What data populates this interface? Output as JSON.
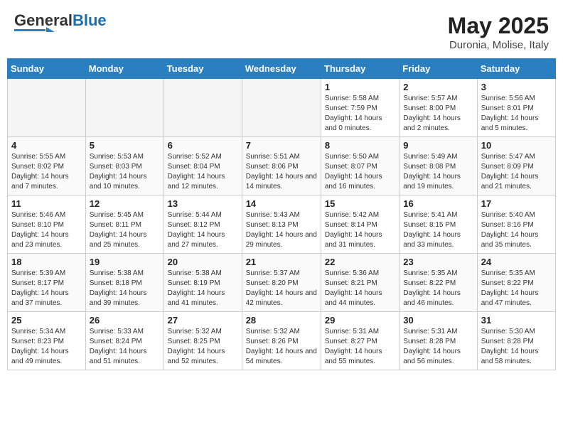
{
  "header": {
    "logo_general": "General",
    "logo_blue": "Blue",
    "month_title": "May 2025",
    "location": "Duronia, Molise, Italy"
  },
  "days_of_week": [
    "Sunday",
    "Monday",
    "Tuesday",
    "Wednesday",
    "Thursday",
    "Friday",
    "Saturday"
  ],
  "weeks": [
    [
      {
        "num": "",
        "info": ""
      },
      {
        "num": "",
        "info": ""
      },
      {
        "num": "",
        "info": ""
      },
      {
        "num": "",
        "info": ""
      },
      {
        "num": "1",
        "info": "Sunrise: 5:58 AM\nSunset: 7:59 PM\nDaylight: 14 hours and 0 minutes."
      },
      {
        "num": "2",
        "info": "Sunrise: 5:57 AM\nSunset: 8:00 PM\nDaylight: 14 hours and 2 minutes."
      },
      {
        "num": "3",
        "info": "Sunrise: 5:56 AM\nSunset: 8:01 PM\nDaylight: 14 hours and 5 minutes."
      }
    ],
    [
      {
        "num": "4",
        "info": "Sunrise: 5:55 AM\nSunset: 8:02 PM\nDaylight: 14 hours and 7 minutes."
      },
      {
        "num": "5",
        "info": "Sunrise: 5:53 AM\nSunset: 8:03 PM\nDaylight: 14 hours and 10 minutes."
      },
      {
        "num": "6",
        "info": "Sunrise: 5:52 AM\nSunset: 8:04 PM\nDaylight: 14 hours and 12 minutes."
      },
      {
        "num": "7",
        "info": "Sunrise: 5:51 AM\nSunset: 8:06 PM\nDaylight: 14 hours and 14 minutes."
      },
      {
        "num": "8",
        "info": "Sunrise: 5:50 AM\nSunset: 8:07 PM\nDaylight: 14 hours and 16 minutes."
      },
      {
        "num": "9",
        "info": "Sunrise: 5:49 AM\nSunset: 8:08 PM\nDaylight: 14 hours and 19 minutes."
      },
      {
        "num": "10",
        "info": "Sunrise: 5:47 AM\nSunset: 8:09 PM\nDaylight: 14 hours and 21 minutes."
      }
    ],
    [
      {
        "num": "11",
        "info": "Sunrise: 5:46 AM\nSunset: 8:10 PM\nDaylight: 14 hours and 23 minutes."
      },
      {
        "num": "12",
        "info": "Sunrise: 5:45 AM\nSunset: 8:11 PM\nDaylight: 14 hours and 25 minutes."
      },
      {
        "num": "13",
        "info": "Sunrise: 5:44 AM\nSunset: 8:12 PM\nDaylight: 14 hours and 27 minutes."
      },
      {
        "num": "14",
        "info": "Sunrise: 5:43 AM\nSunset: 8:13 PM\nDaylight: 14 hours and 29 minutes."
      },
      {
        "num": "15",
        "info": "Sunrise: 5:42 AM\nSunset: 8:14 PM\nDaylight: 14 hours and 31 minutes."
      },
      {
        "num": "16",
        "info": "Sunrise: 5:41 AM\nSunset: 8:15 PM\nDaylight: 14 hours and 33 minutes."
      },
      {
        "num": "17",
        "info": "Sunrise: 5:40 AM\nSunset: 8:16 PM\nDaylight: 14 hours and 35 minutes."
      }
    ],
    [
      {
        "num": "18",
        "info": "Sunrise: 5:39 AM\nSunset: 8:17 PM\nDaylight: 14 hours and 37 minutes."
      },
      {
        "num": "19",
        "info": "Sunrise: 5:38 AM\nSunset: 8:18 PM\nDaylight: 14 hours and 39 minutes."
      },
      {
        "num": "20",
        "info": "Sunrise: 5:38 AM\nSunset: 8:19 PM\nDaylight: 14 hours and 41 minutes."
      },
      {
        "num": "21",
        "info": "Sunrise: 5:37 AM\nSunset: 8:20 PM\nDaylight: 14 hours and 42 minutes."
      },
      {
        "num": "22",
        "info": "Sunrise: 5:36 AM\nSunset: 8:21 PM\nDaylight: 14 hours and 44 minutes."
      },
      {
        "num": "23",
        "info": "Sunrise: 5:35 AM\nSunset: 8:22 PM\nDaylight: 14 hours and 46 minutes."
      },
      {
        "num": "24",
        "info": "Sunrise: 5:35 AM\nSunset: 8:22 PM\nDaylight: 14 hours and 47 minutes."
      }
    ],
    [
      {
        "num": "25",
        "info": "Sunrise: 5:34 AM\nSunset: 8:23 PM\nDaylight: 14 hours and 49 minutes."
      },
      {
        "num": "26",
        "info": "Sunrise: 5:33 AM\nSunset: 8:24 PM\nDaylight: 14 hours and 51 minutes."
      },
      {
        "num": "27",
        "info": "Sunrise: 5:32 AM\nSunset: 8:25 PM\nDaylight: 14 hours and 52 minutes."
      },
      {
        "num": "28",
        "info": "Sunrise: 5:32 AM\nSunset: 8:26 PM\nDaylight: 14 hours and 54 minutes."
      },
      {
        "num": "29",
        "info": "Sunrise: 5:31 AM\nSunset: 8:27 PM\nDaylight: 14 hours and 55 minutes."
      },
      {
        "num": "30",
        "info": "Sunrise: 5:31 AM\nSunset: 8:28 PM\nDaylight: 14 hours and 56 minutes."
      },
      {
        "num": "31",
        "info": "Sunrise: 5:30 AM\nSunset: 8:28 PM\nDaylight: 14 hours and 58 minutes."
      }
    ]
  ]
}
